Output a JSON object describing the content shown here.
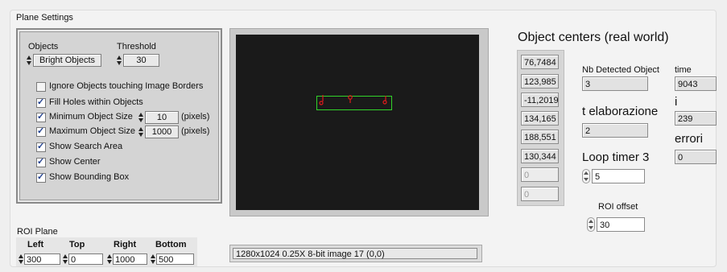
{
  "plane_settings": {
    "title": "Plane Settings",
    "objects_label": "Objects",
    "objects_value": "Bright Objects",
    "threshold_label": "Threshold",
    "threshold_value": "30",
    "options": [
      {
        "label": "Ignore Objects touching Image Borders",
        "checked": false
      },
      {
        "label": "Fill Holes within Objects",
        "checked": true
      },
      {
        "label": "Minimum Object Size",
        "checked": true
      },
      {
        "label": "Maximum Object Size",
        "checked": true
      },
      {
        "label": "Show Search Area",
        "checked": true
      },
      {
        "label": "Show Center",
        "checked": true
      },
      {
        "label": "Show Bounding Box",
        "checked": true
      }
    ],
    "min_size": "10",
    "max_size": "1000",
    "pixels_unit": "(pixels)"
  },
  "roi_plane": {
    "title": "ROI Plane",
    "headers": [
      "Left",
      "Top",
      "Right",
      "Bottom"
    ],
    "values": [
      "300",
      "0",
      "1000",
      "500"
    ]
  },
  "image": {
    "status": "1280x1024 0.25X 8-bit image 17    (0,0)"
  },
  "object_centers": {
    "title": "Object centers (real world)",
    "values": [
      "76,7484",
      "123,985",
      "-11,2019",
      "134,165",
      "188,551",
      "130,344",
      "0",
      "0"
    ]
  },
  "indicators": {
    "nb_detected_label": "Nb Detected Object",
    "nb_detected_value": "3",
    "time_label": "time",
    "time_value": "9043",
    "t_elab_label": "t elaborazione",
    "t_elab_value": "2",
    "i_label": "i",
    "i_value": "239",
    "errori_label": "errori",
    "errori_value": "0",
    "loop_timer_label": "Loop timer 3",
    "loop_timer_value": "5",
    "roi_offset_label": "ROI offset",
    "roi_offset_value": "30"
  },
  "colors": {
    "roi_rect": "#32d22a",
    "marker": "#e11b1b",
    "image_bg": "#1a1a1a"
  }
}
